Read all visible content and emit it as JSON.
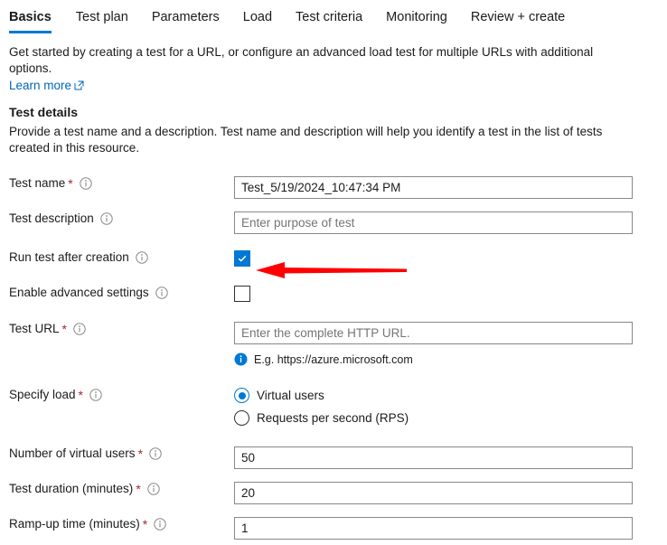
{
  "tabs": [
    {
      "label": "Basics",
      "active": true
    },
    {
      "label": "Test plan",
      "active": false
    },
    {
      "label": "Parameters",
      "active": false
    },
    {
      "label": "Load",
      "active": false
    },
    {
      "label": "Test criteria",
      "active": false
    },
    {
      "label": "Monitoring",
      "active": false
    },
    {
      "label": "Review + create",
      "active": false
    }
  ],
  "intro": {
    "text": "Get started by creating a test for a URL, or configure an advanced load test for multiple URLs with additional options.",
    "learn_more": "Learn more",
    "learn_more_icon": "external-link-icon"
  },
  "section": {
    "title": "Test details",
    "description": "Provide a test name and a description. Test name and description will help you identify a test in the list of tests created in this resource."
  },
  "fields": {
    "test_name": {
      "label": "Test name",
      "required": "*",
      "info_icon": "info-icon",
      "value": "Test_5/19/2024_10:47:34 PM",
      "placeholder": ""
    },
    "test_description": {
      "label": "Test description",
      "required": "",
      "info_icon": "info-icon",
      "value": "",
      "placeholder": "Enter purpose of test"
    },
    "run_test_after_creation": {
      "label": "Run test after creation",
      "info_icon": "info-icon",
      "checked": true
    },
    "enable_advanced_settings": {
      "label": "Enable advanced settings",
      "info_icon": "info-icon",
      "checked": false
    },
    "test_url": {
      "label": "Test URL",
      "required": "*",
      "info_icon": "info-icon",
      "value": "",
      "placeholder": "Enter the complete HTTP URL.",
      "hint": "E.g. https://azure.microsoft.com",
      "hint_icon": "info-filled-icon"
    },
    "specify_load": {
      "label": "Specify load",
      "required": "*",
      "info_icon": "info-icon",
      "options": [
        {
          "label": "Virtual users",
          "selected": true
        },
        {
          "label": "Requests per second (RPS)",
          "selected": false
        }
      ]
    },
    "number_of_virtual_users": {
      "label": "Number of virtual users",
      "required": "*",
      "info_icon": "info-icon",
      "value": "50",
      "placeholder": ""
    },
    "test_duration": {
      "label": "Test duration (minutes)",
      "required": "*",
      "info_icon": "info-icon",
      "value": "20",
      "placeholder": ""
    },
    "ramp_up_time": {
      "label": "Ramp-up time (minutes)",
      "required": "*",
      "info_icon": "info-icon",
      "value": "1",
      "placeholder": ""
    }
  },
  "annotation": {
    "arrow_icon": "red-arrow-pointing-left",
    "color": "#ff0000"
  },
  "colors": {
    "accent": "#0078d4",
    "link": "#0067b8",
    "required_asterisk": "#a4262c",
    "annotation": "#ff0000"
  }
}
